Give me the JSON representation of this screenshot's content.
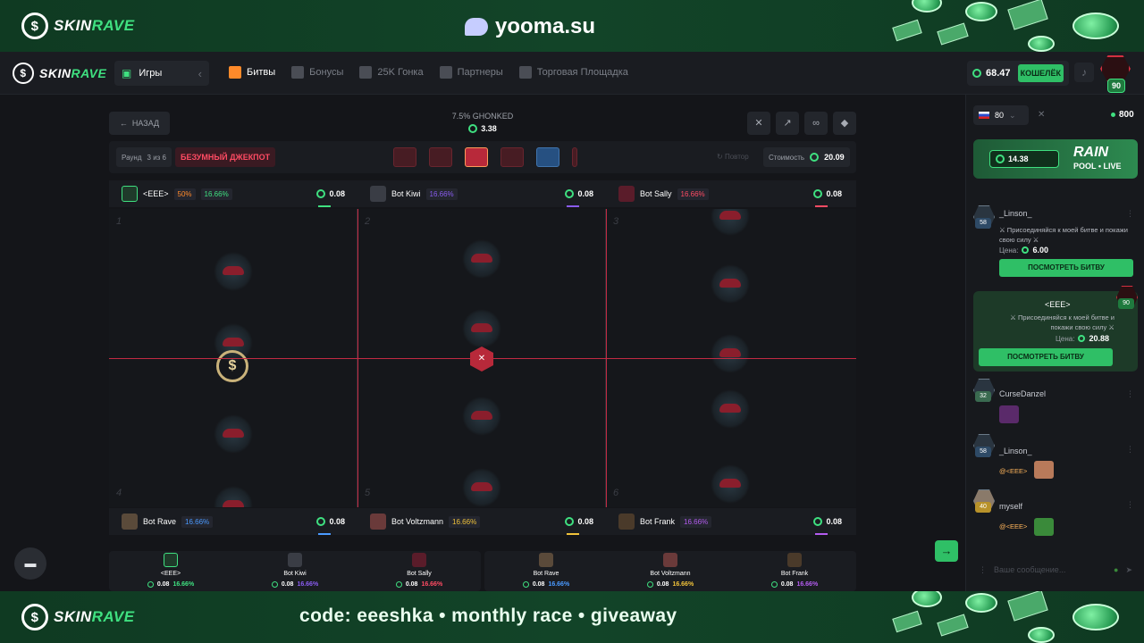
{
  "stream": {
    "brand": "SKINRAVE",
    "brand_white": "SKIN",
    "brand_green": "RAVE",
    "promo_site": "yooma.su",
    "bottom_text": "code: eeeshka  •  monthly race  •  giveaway"
  },
  "header": {
    "brand_white": "SKIN",
    "brand_green": "RAVE",
    "games_label": "Игры",
    "nav": [
      {
        "label": "Битвы",
        "active": true
      },
      {
        "label": "Бонусы"
      },
      {
        "label": "25K Гонка"
      },
      {
        "label": "Партнеры"
      },
      {
        "label": "Торговая Площадка"
      }
    ],
    "balance": "68.47",
    "wallet_label": "КОШЕЛЁК",
    "level": "90"
  },
  "battle": {
    "back_label": "НАЗАД",
    "gonked_label": "7.5% GHONKED",
    "gonked_value": "3.38",
    "round_label": "Раунд",
    "round_value": "3 из 6",
    "mode_label": "БЕЗУМНЫЙ ДЖЕКПОТ",
    "repeat_label": "Повтор",
    "cost_label": "Стоимость",
    "cost_value": "20.09",
    "top_players": [
      {
        "name": "<EEE>",
        "win_pct": "50%",
        "pct": "16.66%",
        "amount": "0.08",
        "color": "#3fe080"
      },
      {
        "name": "Bot Kiwi",
        "pct": "16.66%",
        "amount": "0.08",
        "color": "#8a5cf0"
      },
      {
        "name": "Bot Sally",
        "pct": "16.66%",
        "amount": "0.08",
        "color": "#ff4b63"
      }
    ],
    "bottom_players": [
      {
        "name": "Bot Rave",
        "pct": "16.66%",
        "amount": "0.08",
        "color": "#4a9aff"
      },
      {
        "name": "Bot Voltzmann",
        "pct": "16.66%",
        "amount": "0.08",
        "color": "#f0c23a"
      },
      {
        "name": "Bot Frank",
        "pct": "16.66%",
        "amount": "0.08",
        "color": "#b45cf0"
      }
    ],
    "cell_numbers": [
      "1",
      "2",
      "3",
      "4",
      "5",
      "6"
    ],
    "summary_left": [
      {
        "name": "<EEE>",
        "amount": "0.08",
        "pct": "16.66%",
        "color": "#3fe080"
      },
      {
        "name": "Bot Kiwi",
        "amount": "0.08",
        "pct": "16.66%",
        "color": "#8a5cf0"
      },
      {
        "name": "Bot Sally",
        "amount": "0.08",
        "pct": "16.66%",
        "color": "#ff4b63"
      }
    ],
    "summary_right": [
      {
        "name": "Bot Rave",
        "amount": "0.08",
        "pct": "16.66%",
        "color": "#4a9aff"
      },
      {
        "name": "Bot Voltzmann",
        "amount": "0.08",
        "pct": "16.66%",
        "color": "#f0c23a"
      },
      {
        "name": "Bot Frank",
        "amount": "0.08",
        "pct": "16.66%",
        "color": "#b45cf0"
      }
    ]
  },
  "chat": {
    "lang_value": "80",
    "online": "800",
    "rain_amount": "14.38",
    "rain_title": "RAIN",
    "rain_sub": "POOL • LIVE",
    "messages": [
      {
        "user": "_Linson_",
        "level": "58",
        "text": "⚔ Присоединяйся к моей битве и покажи свою силу ⚔",
        "price_label": "Цена:",
        "price": "6.00",
        "button": "ПОСМОТРЕТЬ БИТВУ"
      },
      {
        "user": "<EEE>",
        "level": "90",
        "text": "⚔ Присоединяйся к моей битве и покажи свою силу ⚔",
        "price_label": "Цена:",
        "price": "20.88",
        "button": "ПОСМОТРЕТЬ БИТВУ"
      },
      {
        "user": "CurseDanzel",
        "level": "32"
      },
      {
        "user": "_Linson_",
        "level": "58",
        "text": "@<EEE>"
      },
      {
        "user": "myself",
        "level": "40",
        "text": "@<EEE>"
      }
    ],
    "input_placeholder": "Ваше сообщение..."
  }
}
